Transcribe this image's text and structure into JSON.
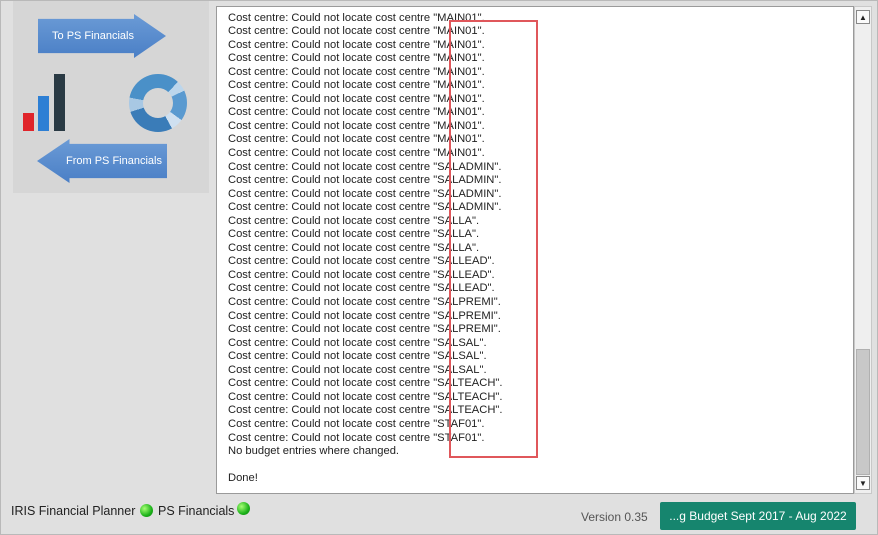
{
  "left_panel": {
    "to_label": "To PS Financials",
    "from_label": "From PS Financials",
    "colors": {
      "arrow": "#4a7fc6",
      "bar_red": "#e0242a",
      "bar_blue": "#2d7fd4",
      "bar_dark": "#2a3a44"
    }
  },
  "log": {
    "lines": [
      "Cost centre: Could not locate cost centre \"MAIN01\".",
      "Cost centre: Could not locate cost centre \"MAIN01\".",
      "Cost centre: Could not locate cost centre \"MAIN01\".",
      "Cost centre: Could not locate cost centre \"MAIN01\".",
      "Cost centre: Could not locate cost centre \"MAIN01\".",
      "Cost centre: Could not locate cost centre \"MAIN01\".",
      "Cost centre: Could not locate cost centre \"MAIN01\".",
      "Cost centre: Could not locate cost centre \"MAIN01\".",
      "Cost centre: Could not locate cost centre \"MAIN01\".",
      "Cost centre: Could not locate cost centre \"MAIN01\".",
      "Cost centre: Could not locate cost centre \"MAIN01\".",
      "Cost centre: Could not locate cost centre \"MAIN01\".",
      "Cost centre: Could not locate cost centre \"SALADMIN\".",
      "Cost centre: Could not locate cost centre \"SALADMIN\".",
      "Cost centre: Could not locate cost centre \"SALADMIN\".",
      "Cost centre: Could not locate cost centre \"SALADMIN\".",
      "Cost centre: Could not locate cost centre \"SALLA\".",
      "Cost centre: Could not locate cost centre \"SALLA\".",
      "Cost centre: Could not locate cost centre \"SALLA\".",
      "Cost centre: Could not locate cost centre \"SALLEAD\".",
      "Cost centre: Could not locate cost centre \"SALLEAD\".",
      "Cost centre: Could not locate cost centre \"SALLEAD\".",
      "Cost centre: Could not locate cost centre \"SALPREMI\".",
      "Cost centre: Could not locate cost centre \"SALPREMI\".",
      "Cost centre: Could not locate cost centre \"SALPREMI\".",
      "Cost centre: Could not locate cost centre \"SALSAL\".",
      "Cost centre: Could not locate cost centre \"SALSAL\".",
      "Cost centre: Could not locate cost centre \"SALSAL\".",
      "Cost centre: Could not locate cost centre \"SALTEACH\".",
      "Cost centre: Could not locate cost centre \"SALTEACH\".",
      "Cost centre: Could not locate cost centre \"SALTEACH\".",
      "Cost centre: Could not locate cost centre \"STAF01\".",
      "Cost centre: Could not locate cost centre \"STAF01\".",
      "No budget entries where changed.",
      "",
      "Done!"
    ],
    "highlight_color": "#e0575b"
  },
  "status_bar": {
    "app_name": "IRIS Financial Planner",
    "connection_label": "PS Financials",
    "version": "Version 0.35",
    "budget_label": "...g Budget Sept 2017 - Aug 2022",
    "budget_color": "#16856e",
    "indicator_color": "#1cb21a"
  }
}
